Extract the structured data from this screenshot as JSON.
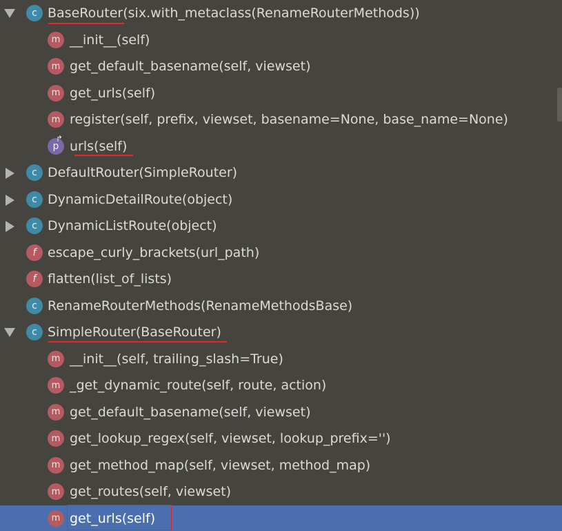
{
  "tree": {
    "rows": [
      {
        "label": "BaseRouter(six.with_metaclass(RenameRouterMethods))",
        "icon": "c",
        "level": 0,
        "expand": "down"
      },
      {
        "label": "__init__(self)",
        "icon": "m",
        "level": 1
      },
      {
        "label": "get_default_basename(self, viewset)",
        "icon": "m",
        "level": 1
      },
      {
        "label": "get_urls(self)",
        "icon": "m",
        "level": 1
      },
      {
        "label": "register(self, prefix, viewset, basename=None, base_name=None)",
        "icon": "m",
        "level": 1
      },
      {
        "label": "urls(self)",
        "icon": "p",
        "level": 1
      },
      {
        "label": "DefaultRouter(SimpleRouter)",
        "icon": "c",
        "level": 0,
        "expand": "right"
      },
      {
        "label": "DynamicDetailRoute(object)",
        "icon": "c",
        "level": 0,
        "expand": "right"
      },
      {
        "label": "DynamicListRoute(object)",
        "icon": "c",
        "level": 0,
        "expand": "right"
      },
      {
        "label": "escape_curly_brackets(url_path)",
        "icon": "f",
        "level": 0
      },
      {
        "label": "flatten(list_of_lists)",
        "icon": "f",
        "level": 0
      },
      {
        "label": "RenameRouterMethods(RenameMethodsBase)",
        "icon": "c",
        "level": 0
      },
      {
        "label": "SimpleRouter(BaseRouter)",
        "icon": "c",
        "level": 0,
        "expand": "down"
      },
      {
        "label": "__init__(self, trailing_slash=True)",
        "icon": "m",
        "level": 1
      },
      {
        "label": "_get_dynamic_route(self, route, action)",
        "icon": "m",
        "level": 1
      },
      {
        "label": "get_default_basename(self, viewset)",
        "icon": "m",
        "level": 1
      },
      {
        "label": "get_lookup_regex(self, viewset, lookup_prefix='')",
        "icon": "m",
        "level": 1
      },
      {
        "label": "get_method_map(self, viewset, method_map)",
        "icon": "m",
        "level": 1
      },
      {
        "label": "get_routes(self, viewset)",
        "icon": "m",
        "level": 1
      },
      {
        "label": "get_urls(self)",
        "icon": "m",
        "level": 1,
        "selected": true
      }
    ]
  },
  "icon_letters": {
    "c": "c",
    "m": "m",
    "f": "f",
    "p": "p"
  },
  "colors": {
    "background": "#45443f",
    "selection": "#4b6eaf",
    "annotation": "#e02a2a"
  }
}
